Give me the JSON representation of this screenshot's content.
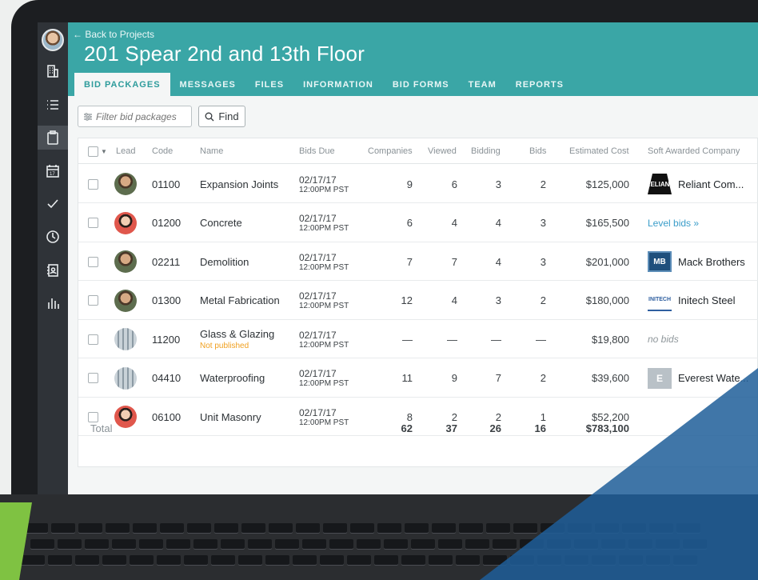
{
  "app": {
    "back_link": "← Back to Projects",
    "project_title": "201 Spear 2nd and 13th Floor"
  },
  "sidebar": {
    "items": [
      {
        "icon": "building-icon"
      },
      {
        "icon": "list-icon"
      },
      {
        "icon": "clipboard-icon",
        "active": true
      },
      {
        "icon": "calendar-icon",
        "label": "17"
      },
      {
        "icon": "checkmark-icon"
      },
      {
        "icon": "clock-icon"
      },
      {
        "icon": "contacts-icon"
      },
      {
        "icon": "bar-chart-icon"
      }
    ]
  },
  "tabs": [
    {
      "label": "BID PACKAGES",
      "active": true
    },
    {
      "label": "MESSAGES"
    },
    {
      "label": "FILES"
    },
    {
      "label": "INFORMATION"
    },
    {
      "label": "BID FORMS"
    },
    {
      "label": "TEAM"
    },
    {
      "label": "REPORTS"
    }
  ],
  "toolbar": {
    "filter_placeholder": "Filter bid packages",
    "find_label": "Find"
  },
  "table": {
    "headers": {
      "lead": "Lead",
      "code": "Code",
      "name": "Name",
      "bids_due": "Bids Due",
      "companies": "Companies",
      "viewed": "Viewed",
      "bidding": "Bidding",
      "bids": "Bids",
      "estimated_cost": "Estimated Cost",
      "soft_awarded": "Soft Awarded Company"
    },
    "rows": [
      {
        "lead": "man",
        "code": "01100",
        "name": "Expansion Joints",
        "note": "",
        "due_date": "02/17/17",
        "due_time": "12:00PM PST",
        "companies": "9",
        "viewed": "6",
        "bidding": "3",
        "bids": "2",
        "cost": "$125,000",
        "award": {
          "type": "company",
          "logo": "reliant",
          "logo_text": "RELIANT",
          "name": "Reliant Com..."
        }
      },
      {
        "lead": "woman",
        "code": "01200",
        "name": "Concrete",
        "note": "",
        "due_date": "02/17/17",
        "due_time": "12:00PM PST",
        "companies": "6",
        "viewed": "4",
        "bidding": "4",
        "bids": "3",
        "cost": "$165,500",
        "award": {
          "type": "link",
          "name": "Level bids »"
        }
      },
      {
        "lead": "man",
        "code": "02211",
        "name": "Demolition",
        "note": "",
        "due_date": "02/17/17",
        "due_time": "12:00PM PST",
        "companies": "7",
        "viewed": "7",
        "bidding": "4",
        "bids": "3",
        "cost": "$201,000",
        "award": {
          "type": "company",
          "logo": "mb",
          "logo_text": "MB",
          "name": "Mack Brothers"
        }
      },
      {
        "lead": "man",
        "code": "01300",
        "name": "Metal Fabrication",
        "note": "",
        "due_date": "02/17/17",
        "due_time": "12:00PM PST",
        "companies": "12",
        "viewed": "4",
        "bidding": "3",
        "bids": "2",
        "cost": "$180,000",
        "award": {
          "type": "company",
          "logo": "initech",
          "logo_text": "INITECH",
          "name": "Initech Steel"
        }
      },
      {
        "lead": "building",
        "code": "11200",
        "name": "Glass & Glazing",
        "note": "Not published",
        "due_date": "02/17/17",
        "due_time": "12:00PM PST",
        "companies": "—",
        "viewed": "—",
        "bidding": "—",
        "bids": "—",
        "cost": "$19,800",
        "award": {
          "type": "none",
          "name": "no bids"
        }
      },
      {
        "lead": "building",
        "code": "04410",
        "name": "Waterproofing",
        "note": "",
        "due_date": "02/17/17",
        "due_time": "12:00PM PST",
        "companies": "11",
        "viewed": "9",
        "bidding": "7",
        "bids": "2",
        "cost": "$39,600",
        "award": {
          "type": "company",
          "logo": "everest",
          "logo_text": "E",
          "name": "Everest Wate..."
        }
      },
      {
        "lead": "woman",
        "code": "06100",
        "name": "Unit Masonry",
        "note": "",
        "due_date": "02/17/17",
        "due_time": "12:00PM PST",
        "companies": "8",
        "viewed": "2",
        "bidding": "2",
        "bids": "1",
        "cost": "$52,200",
        "award": {
          "type": "none",
          "name": ""
        }
      }
    ],
    "total": {
      "label": "Total",
      "companies": "62",
      "viewed": "37",
      "bidding": "26",
      "bids": "16",
      "cost": "$783,100"
    }
  }
}
